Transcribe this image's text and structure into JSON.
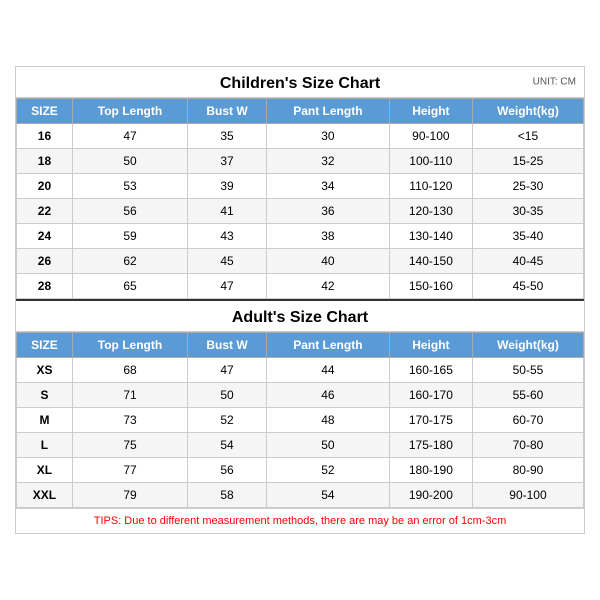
{
  "children_title": "Children's Size Chart",
  "adult_title": "Adult's Size Chart",
  "unit_label": "UNIT: CM",
  "tips": "TIPS: Due to different measurement methods, there are may be an error of 1cm-3cm",
  "headers": [
    "SIZE",
    "Top Length",
    "Bust W",
    "Pant Length",
    "Height",
    "Weight(kg)"
  ],
  "children_rows": [
    [
      "16",
      "47",
      "35",
      "30",
      "90-100",
      "<15"
    ],
    [
      "18",
      "50",
      "37",
      "32",
      "100-110",
      "15-25"
    ],
    [
      "20",
      "53",
      "39",
      "34",
      "110-120",
      "25-30"
    ],
    [
      "22",
      "56",
      "41",
      "36",
      "120-130",
      "30-35"
    ],
    [
      "24",
      "59",
      "43",
      "38",
      "130-140",
      "35-40"
    ],
    [
      "26",
      "62",
      "45",
      "40",
      "140-150",
      "40-45"
    ],
    [
      "28",
      "65",
      "47",
      "42",
      "150-160",
      "45-50"
    ]
  ],
  "adult_rows": [
    [
      "XS",
      "68",
      "47",
      "44",
      "160-165",
      "50-55"
    ],
    [
      "S",
      "71",
      "50",
      "46",
      "160-170",
      "55-60"
    ],
    [
      "M",
      "73",
      "52",
      "48",
      "170-175",
      "60-70"
    ],
    [
      "L",
      "75",
      "54",
      "50",
      "175-180",
      "70-80"
    ],
    [
      "XL",
      "77",
      "56",
      "52",
      "180-190",
      "80-90"
    ],
    [
      "XXL",
      "79",
      "58",
      "54",
      "190-200",
      "90-100"
    ]
  ]
}
